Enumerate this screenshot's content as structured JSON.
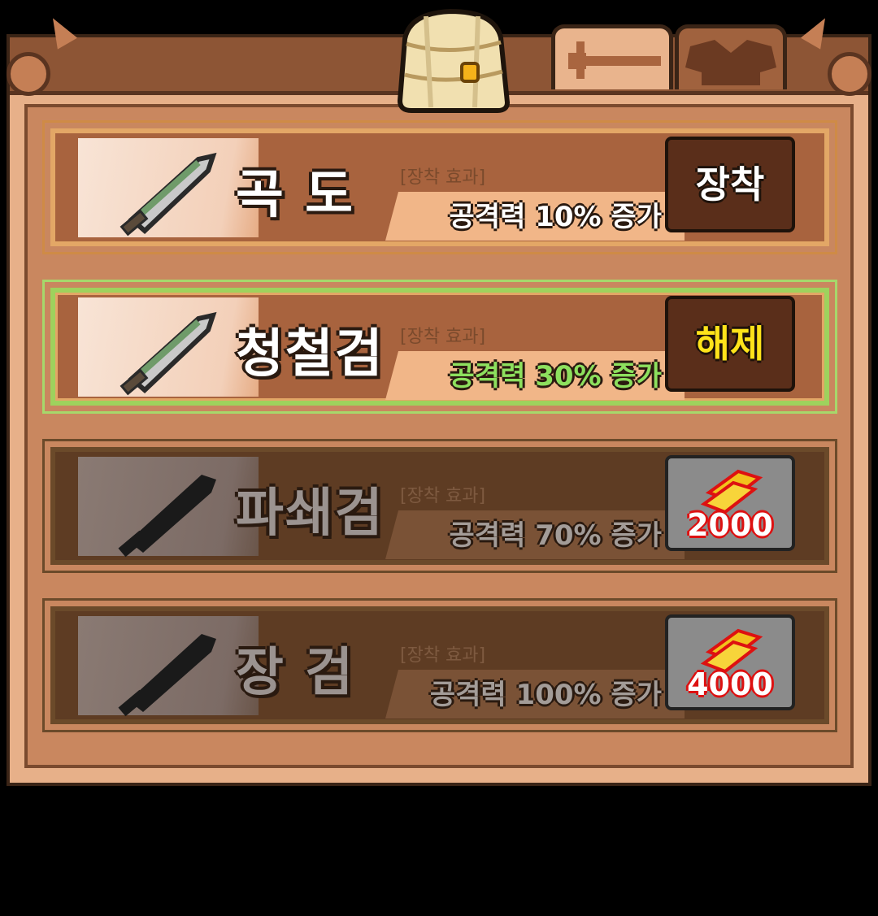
{
  "tabs": [
    {
      "name": "weapon",
      "icon": "sword-icon",
      "active": true
    },
    {
      "name": "armor",
      "icon": "armor-icon",
      "active": false
    }
  ],
  "items": [
    {
      "name": "곡  도",
      "effect_label": "[장착 효과]",
      "effect": "공격력 10% 증가",
      "state": "owned",
      "button": "장착",
      "price": ""
    },
    {
      "name": "청철검",
      "effect_label": "[장착 효과]",
      "effect": "공격력 30% 증가",
      "state": "equipped",
      "button": "해제",
      "price": ""
    },
    {
      "name": "파쇄검",
      "effect_label": "[장착 효과]",
      "effect": "공격력 70% 증가",
      "state": "locked",
      "button": "",
      "price": "2000"
    },
    {
      "name": "장  검",
      "effect_label": "[장착 효과]",
      "effect": "공격력 100% 증가",
      "state": "locked",
      "button": "",
      "price": "4000"
    }
  ],
  "colors": {
    "equip_text": "#ffffff",
    "unequip_text": "#ffe31a",
    "equipped_effect": "#8de05e",
    "price_outline": "#dd1111"
  }
}
